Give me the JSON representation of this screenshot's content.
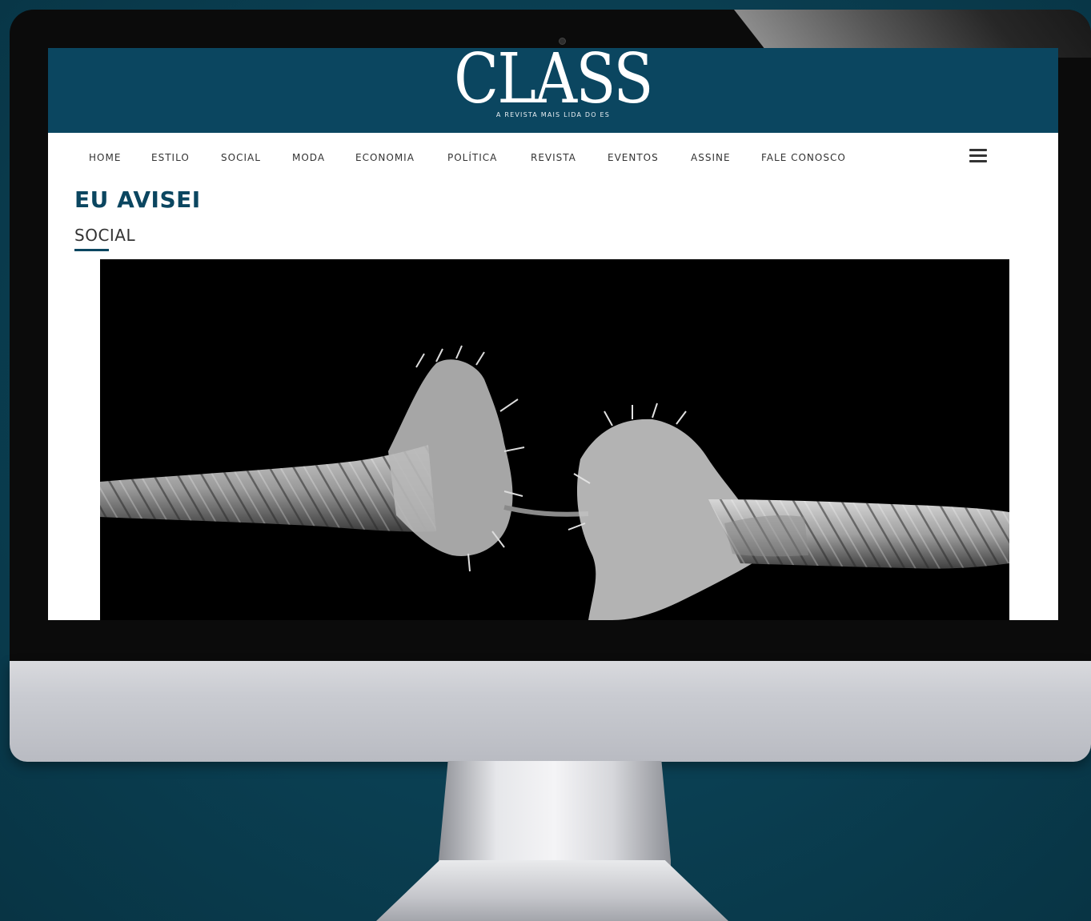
{
  "site": {
    "logo": "CLASS",
    "tagline": "A REVISTA MAIS LIDA DO ES"
  },
  "nav": {
    "items": [
      {
        "label": "HOME"
      },
      {
        "label": "ESTILO"
      },
      {
        "label": "SOCIAL"
      },
      {
        "label": "MODA"
      },
      {
        "label": "ECONOMIA"
      },
      {
        "label": "POLÍTICA"
      },
      {
        "label": "REVISTA"
      },
      {
        "label": "EVENTOS"
      },
      {
        "label": "ASSINE"
      },
      {
        "label": "FALE CONOSCO"
      }
    ],
    "menu_icon": "hamburger-menu-icon"
  },
  "article": {
    "title": "EU AVISEI",
    "category": "SOCIAL",
    "hero_image": "frayed-rope-breaking-photo"
  },
  "colors": {
    "brand": "#0b4660",
    "background": "#0a3f52",
    "text": "#333333"
  }
}
